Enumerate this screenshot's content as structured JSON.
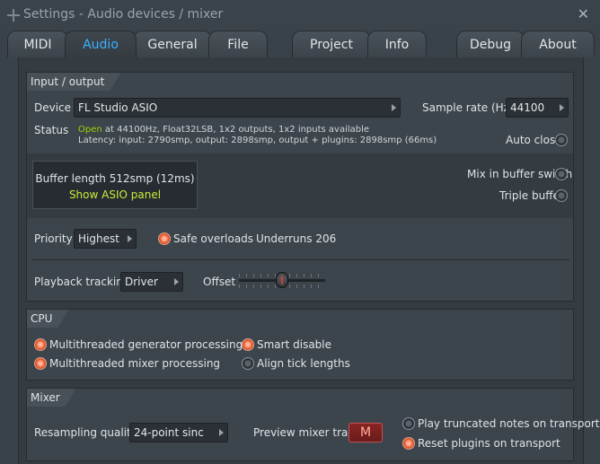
{
  "window": {
    "title": "Settings - Audio devices / mixer"
  },
  "tabs": [
    "MIDI",
    "Audio",
    "General",
    "File",
    "Project",
    "Info",
    "Debug",
    "About"
  ],
  "io": {
    "header": "Input / output",
    "device_label": "Device",
    "device_value": "FL Studio ASIO",
    "sample_rate_label": "Sample rate (Hz)",
    "sample_rate_value": "44100",
    "status_label": "Status",
    "status_open": "Open",
    "status_line1": " at 44100Hz, Float32LSB, 1x2 outputs, 1x2 inputs available",
    "status_line2": "Latency: input: 2790smp, output: 2898smp, output + plugins: 2898smp (66ms)",
    "auto_close_label": "Auto close",
    "buffer_length": "Buffer length 512smp (12ms)",
    "show_asio_panel": "Show ASIO panel",
    "mix_in_buffer_switch": "Mix in buffer switch",
    "triple_buffer": "Triple buffer",
    "priority_label": "Priority",
    "priority_value": "Highest",
    "safe_overloads": "Safe overloads",
    "underruns": "Underruns 206",
    "playback_tracking_label": "Playback tracking",
    "playback_tracking_value": "Driver",
    "offset_label": "Offset"
  },
  "cpu": {
    "header": "CPU",
    "multithreaded_generator": "Multithreaded generator processing",
    "multithreaded_mixer": "Multithreaded mixer processing",
    "smart_disable": "Smart disable",
    "align_tick_lengths": "Align tick lengths"
  },
  "mixer": {
    "header": "Mixer",
    "resampling_label": "Resampling quality",
    "resampling_value": "24-point sinc",
    "preview_label": "Preview mixer track",
    "preview_value": "M",
    "play_truncated": "Play truncated notes on transport",
    "reset_plugins": "Reset plugins on transport"
  },
  "states": {
    "auto_close": false,
    "mix_in_buffer_switch": false,
    "triple_buffer": false,
    "safe_overloads": true,
    "multithreaded_generator": true,
    "multithreaded_mixer": true,
    "smart_disable": true,
    "align_tick_lengths": false,
    "play_truncated": false,
    "reset_plugins": true
  },
  "colors": {
    "accent_tab": "#3ab1ff",
    "status_open": "#9bd300",
    "asio_link": "#c9ec3a",
    "radio_on": "#f06a3e"
  }
}
